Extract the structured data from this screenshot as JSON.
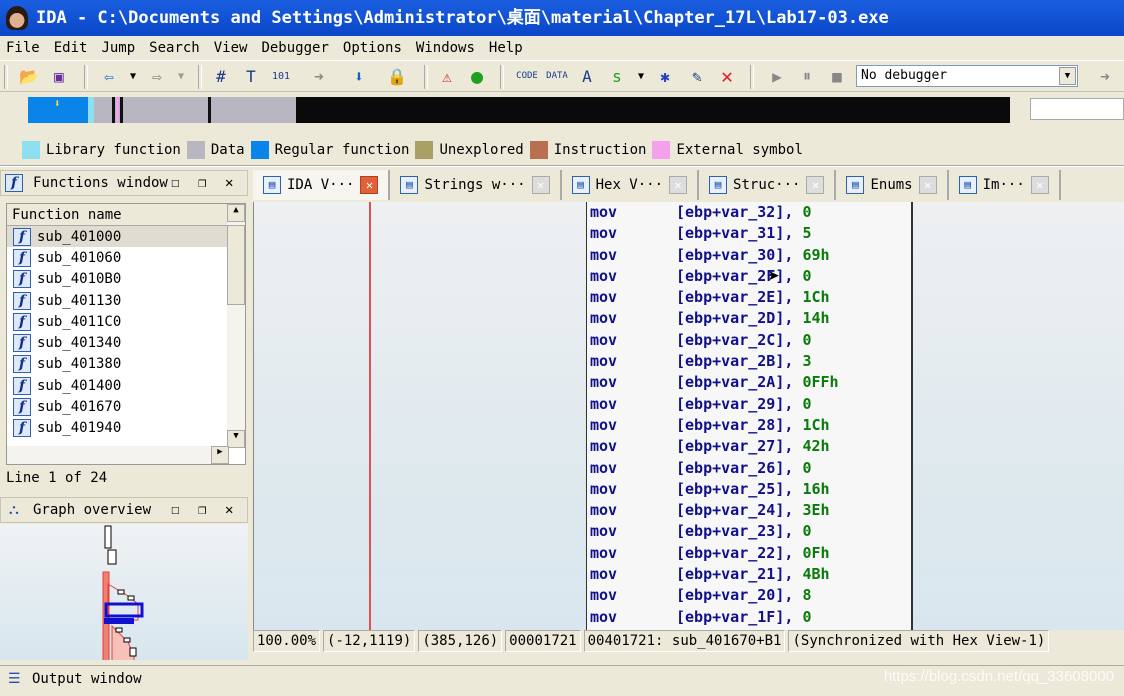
{
  "window": {
    "title": "IDA - C:\\Documents and Settings\\Administrator\\桌面\\material\\Chapter_17L\\Lab17-03.exe"
  },
  "menu": [
    "File",
    "Edit",
    "Jump",
    "Search",
    "View",
    "Debugger",
    "Options",
    "Windows",
    "Help"
  ],
  "toolbar": {
    "debugger_select": "No debugger"
  },
  "legend": [
    {
      "label": "Library function",
      "color": "#8ee0f0"
    },
    {
      "label": "Data",
      "color": "#b8b6c0"
    },
    {
      "label": "Regular function",
      "color": "#0a84e8"
    },
    {
      "label": "Unexplored",
      "color": "#a8a064"
    },
    {
      "label": "Instruction",
      "color": "#b87050"
    },
    {
      "label": "External symbol",
      "color": "#f4a0ec"
    }
  ],
  "functions_window": {
    "title": "Functions window",
    "column": "Function name",
    "items": [
      "sub_401000",
      "sub_401060",
      "sub_4010B0",
      "sub_401130",
      "sub_4011C0",
      "sub_401340",
      "sub_401380",
      "sub_401400",
      "sub_401670",
      "sub_401940"
    ],
    "line_info": "Line 1 of 24"
  },
  "graph_overview": {
    "title": "Graph overview"
  },
  "tabs": [
    {
      "label": "IDA V···",
      "icon": "ida-view-icon"
    },
    {
      "label": "Strings w···",
      "icon": "strings-icon"
    },
    {
      "label": "Hex V···",
      "icon": "hex-icon"
    },
    {
      "label": "Struc···",
      "icon": "struct-icon"
    },
    {
      "label": "Enums",
      "icon": "enums-icon"
    },
    {
      "label": "Im···",
      "icon": "imports-icon"
    }
  ],
  "code": [
    [
      "mov",
      "[ebp+var_32], ",
      "0"
    ],
    [
      "mov",
      "[ebp+var_31], ",
      "5"
    ],
    [
      "mov",
      "[ebp+var_30], ",
      "69h"
    ],
    [
      "mov",
      "[ebp+var_2F], ",
      "0"
    ],
    [
      "mov",
      "[ebp+var_2E], ",
      "1Ch"
    ],
    [
      "mov",
      "[ebp+var_2D], ",
      "14h"
    ],
    [
      "mov",
      "[ebp+var_2C], ",
      "0"
    ],
    [
      "mov",
      "[ebp+var_2B], ",
      "3"
    ],
    [
      "mov",
      "[ebp+var_2A], ",
      "0FFh"
    ],
    [
      "mov",
      "[ebp+var_29], ",
      "0"
    ],
    [
      "mov",
      "[ebp+var_28], ",
      "1Ch"
    ],
    [
      "mov",
      "[ebp+var_27], ",
      "42h"
    ],
    [
      "mov",
      "[ebp+var_26], ",
      "0"
    ],
    [
      "mov",
      "[ebp+var_25], ",
      "16h"
    ],
    [
      "mov",
      "[ebp+var_24], ",
      "3Eh"
    ],
    [
      "mov",
      "[ebp+var_23], ",
      "0"
    ],
    [
      "mov",
      "[ebp+var_22], ",
      "0Fh"
    ],
    [
      "mov",
      "[ebp+var_21], ",
      "4Bh"
    ],
    [
      "mov",
      "[ebp+var_20], ",
      "8"
    ],
    [
      "mov",
      "[ebp+var_1F], ",
      "0"
    ]
  ],
  "status": [
    "100.00%",
    "(-12,1119)",
    "(385,126)",
    "00001721",
    "00401721: sub_401670+B1",
    "(Synchronized with Hex View-1)"
  ],
  "output_window": {
    "title": "Output window"
  },
  "watermark": "https://blog.csdn.net/qq_33608000"
}
